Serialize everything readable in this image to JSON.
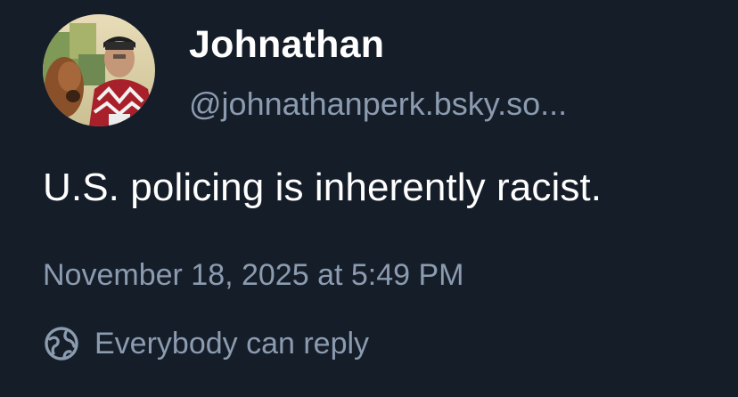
{
  "post": {
    "author": {
      "display_name": "Johnathan",
      "handle": "@johnathanperk.bsky.so...",
      "avatar_icon": "profile-photo"
    },
    "text": "U.S. policing is inherently racist.",
    "timestamp": "November 18, 2025 at 5:49 PM",
    "reply_setting": {
      "icon": "globe-icon",
      "label": "Everybody can reply"
    }
  },
  "colors": {
    "background": "#151d28",
    "primary_text": "#ffffff",
    "secondary_text": "#8b9bb0"
  }
}
